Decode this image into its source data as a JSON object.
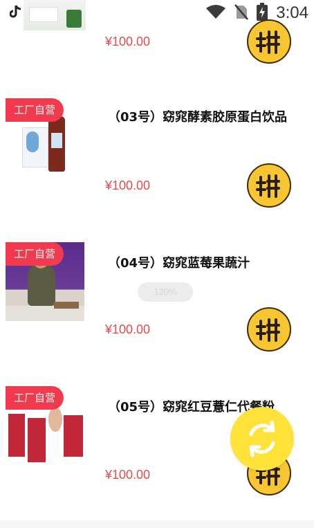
{
  "status": {
    "time": "3:04"
  },
  "products": [
    {
      "badge": "",
      "title": "",
      "price": "¥100.00"
    },
    {
      "badge": "工厂自营",
      "title": "（03号）窈窕酵素胶原蛋白饮品",
      "price": "¥100.00"
    },
    {
      "badge": "工厂自营",
      "title": "（04号）窈窕蓝莓果蔬汁",
      "price": "¥100.00"
    },
    {
      "badge": "工厂自营",
      "title": "（05号）窈窕红豆薏仁代餐粉",
      "price": "¥100.00"
    }
  ],
  "toast": "120%",
  "icons": {
    "group_buy": "pin-character-icon",
    "refresh": "refresh-icon",
    "wifi": "wifi-icon",
    "no_sim": "no-sim-icon",
    "battery": "battery-charging-icon",
    "tiktok": "tiktok-icon"
  },
  "colors": {
    "badge": "#f23a4e",
    "price": "#e84b4b",
    "group_button": "#f7c632",
    "fab": "#ffe23a"
  }
}
